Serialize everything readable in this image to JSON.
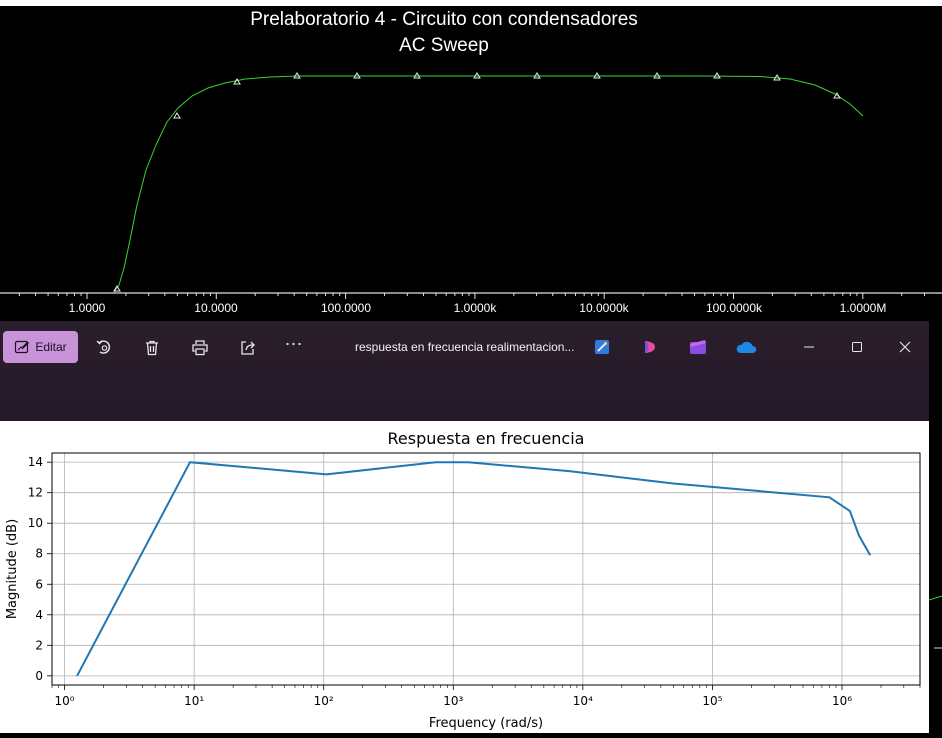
{
  "spice": {
    "title": "Prelaboratorio 4 - Circuito con condensadores",
    "subtitle": "AC Sweep",
    "x_ticks": [
      "1.0000",
      "10.0000",
      "100.0000",
      "1.0000k",
      "10.0000k",
      "100.0000k",
      "1.0000M"
    ]
  },
  "viewer": {
    "edit_label": "Editar",
    "file_name": "respuesta en frecuencia realimentacion..."
  },
  "chart_data": {
    "type": "line",
    "title": "Respuesta en frecuencia",
    "xlabel": "Frequency (rad/s)",
    "ylabel": "Magnitude (dB)",
    "xscale": "log",
    "xlim": [
      0.8,
      4000000
    ],
    "ylim": [
      -0.6,
      14.6
    ],
    "grid": true,
    "x_tick_labels": [
      "10⁰",
      "10¹",
      "10²",
      "10³",
      "10⁴",
      "10⁵",
      "10⁶"
    ],
    "y_tick_labels": [
      "0",
      "2",
      "4",
      "6",
      "8",
      "10",
      "12",
      "14"
    ],
    "series": [
      {
        "color": "#1f77b4",
        "x": [
          1.25,
          9.3,
          105,
          730,
          1300,
          8000,
          50000,
          800000,
          1150000,
          1350000,
          1650000
        ],
        "y": [
          0,
          14,
          13.2,
          14,
          14,
          13.4,
          12.6,
          11.7,
          10.8,
          9.2,
          7.9
        ]
      }
    ]
  }
}
